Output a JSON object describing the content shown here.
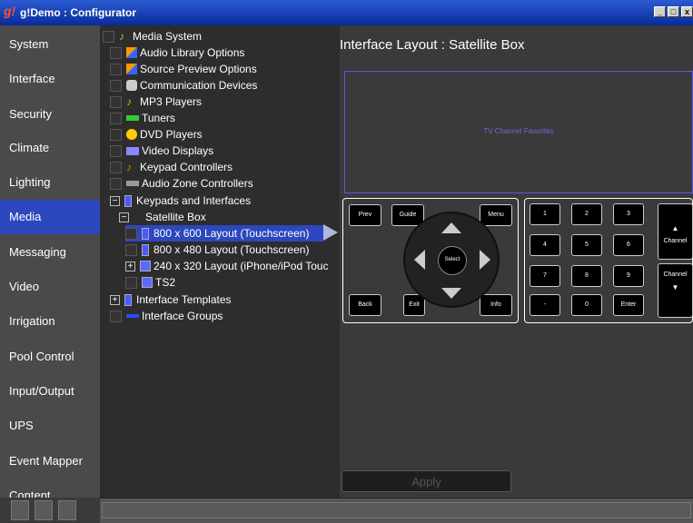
{
  "window": {
    "title": "g!Demo : Configurator"
  },
  "sidebar": {
    "items": [
      {
        "label": "System"
      },
      {
        "label": "Interface"
      },
      {
        "label": "Security"
      },
      {
        "label": "Climate"
      },
      {
        "label": "Lighting"
      },
      {
        "label": "Media",
        "active": true
      },
      {
        "label": "Messaging"
      },
      {
        "label": "Video"
      },
      {
        "label": "Irrigation"
      },
      {
        "label": "Pool Control"
      },
      {
        "label": "Input/Output"
      },
      {
        "label": "UPS"
      },
      {
        "label": "Event Mapper"
      },
      {
        "label": "Content"
      }
    ]
  },
  "tree": {
    "items": [
      {
        "label": "Media System"
      },
      {
        "label": "Audio Library Options"
      },
      {
        "label": "Source Preview Options"
      },
      {
        "label": "Communication Devices"
      },
      {
        "label": "MP3 Players"
      },
      {
        "label": "Tuners"
      },
      {
        "label": "DVD Players"
      },
      {
        "label": "Video Displays"
      },
      {
        "label": "Keypad Controllers"
      },
      {
        "label": "Audio Zone Controllers"
      },
      {
        "label": "Keypads and Interfaces"
      },
      {
        "label": "Satellite Box"
      },
      {
        "label": "800 x 600 Layout (Touchscreen)"
      },
      {
        "label": "800 x 480 Layout (Touchscreen)"
      },
      {
        "label": "240 x 320 Layout (iPhone/iPod Touc"
      },
      {
        "label": "TS2"
      },
      {
        "label": "Interface Templates"
      },
      {
        "label": "Interface Groups"
      }
    ]
  },
  "main": {
    "title": "Interface Layout : Satellite Box",
    "favorites_label": "TV Channel Favorites",
    "nav_keys": {
      "prev": "Prev",
      "guide": "Guide",
      "menu": "Menu",
      "back": "Back",
      "exit": "Exit",
      "info": "Info",
      "select": "Select"
    },
    "numpad": [
      "1",
      "2",
      "3",
      "4",
      "5",
      "6",
      "7",
      "8",
      "9",
      "-",
      "0",
      "Enter"
    ],
    "channel_up": "Channel",
    "channel_down": "Channel",
    "apply_label": "Apply"
  },
  "colors": {
    "accent": "#2d47bf",
    "titlebar": "#0a2a9a"
  }
}
